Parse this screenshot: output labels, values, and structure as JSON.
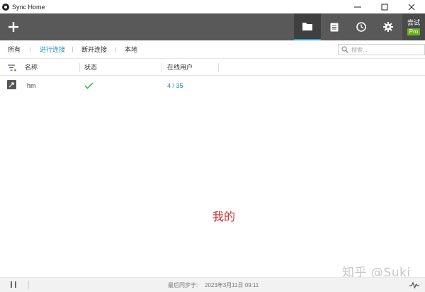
{
  "window": {
    "title": "Sync Home"
  },
  "toolbar": {
    "add_icon": "plus-icon",
    "buttons": [
      {
        "icon": "folder-icon",
        "active": true
      },
      {
        "icon": "document-icon",
        "active": false
      },
      {
        "icon": "clock-icon",
        "active": false
      },
      {
        "icon": "gear-icon",
        "active": false
      }
    ],
    "trial_label": "尝试",
    "pro_badge": "Pro"
  },
  "filters": {
    "tabs": [
      "所有",
      "进行连接",
      "断开连接",
      "本地"
    ],
    "active_index": 1,
    "search_placeholder": "搜索..."
  },
  "table": {
    "columns": [
      "名称",
      "状态",
      "在线用户"
    ],
    "rows": [
      {
        "name": "hm",
        "status_icon": "check-icon",
        "online_users": "4 / 35"
      }
    ]
  },
  "center_text": "我的",
  "footer": {
    "sync_label": "最后同步于:",
    "sync_time": "2023年3月11日 09:11"
  },
  "watermark": "知乎 @Suki",
  "colors": {
    "toolbar_bg": "#595959",
    "accent": "#2ba3d6",
    "check": "#4caf50",
    "pro": "#6ab023",
    "center_text": "#d0312d"
  }
}
